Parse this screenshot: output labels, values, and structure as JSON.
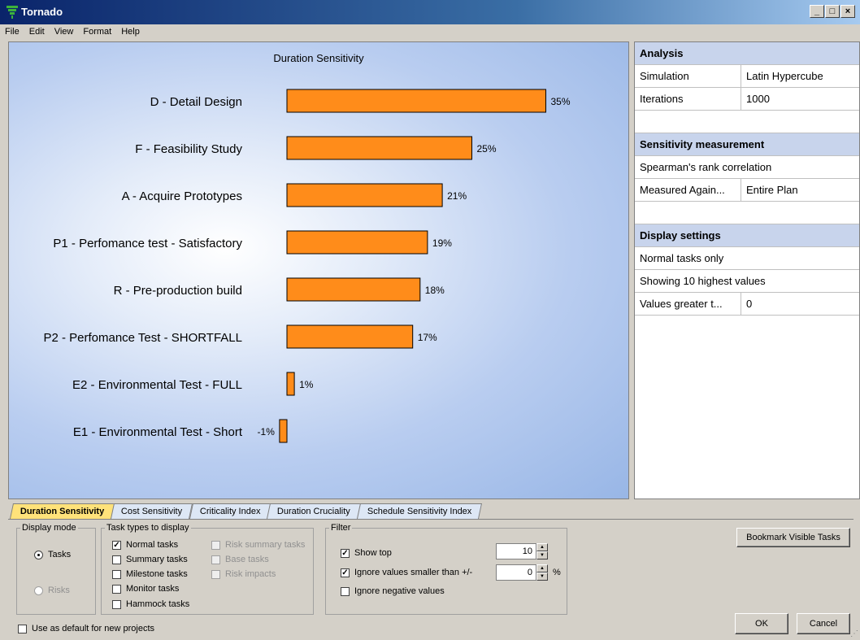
{
  "window": {
    "title": "Tornado"
  },
  "menu": [
    "File",
    "Edit",
    "View",
    "Format",
    "Help"
  ],
  "chart_data": {
    "type": "bar",
    "orientation": "horizontal",
    "title": "Duration Sensitivity",
    "categories": [
      "D - Detail Design",
      "F - Feasibility Study",
      "A - Acquire Prototypes",
      "P1 - Perfomance test - Satisfactory",
      "R - Pre-production build",
      "P2 - Perfomance Test - SHORTFALL",
      "E2 - Environmental Test - FULL",
      "E1 - Environmental Test - Short"
    ],
    "values": [
      35,
      25,
      21,
      19,
      18,
      17,
      1,
      -1
    ],
    "value_labels": [
      "35%",
      "25%",
      "21%",
      "19%",
      "18%",
      "17%",
      "1%",
      "-1%"
    ],
    "bar_color": "#ff8c1a",
    "grid": false
  },
  "panel": {
    "analysis": {
      "header": "Analysis",
      "rows": [
        {
          "label": "Simulation",
          "value": "Latin Hypercube"
        },
        {
          "label": "Iterations",
          "value": "1000"
        }
      ]
    },
    "sensitivity": {
      "header": "Sensitivity measurement",
      "line": "Spearman's rank correlation",
      "rows": [
        {
          "label": "Measured Again...",
          "value": "Entire Plan"
        }
      ]
    },
    "display": {
      "header": "Display settings",
      "lines": [
        "Normal tasks only",
        "Showing 10 highest values"
      ],
      "rows": [
        {
          "label": "Values greater t...",
          "value": "0"
        }
      ]
    }
  },
  "tabs": [
    "Duration Sensitivity",
    "Cost Sensitivity",
    "Criticality Index",
    "Duration Cruciality",
    "Schedule Sensitivity Index"
  ],
  "display_mode": {
    "legend": "Display mode",
    "tasks": "Tasks",
    "risks": "Risks"
  },
  "task_types": {
    "legend": "Task types to display",
    "normal": "Normal tasks",
    "summary": "Summary tasks",
    "milestone": "Milestone tasks",
    "monitor": "Monitor tasks",
    "hammock": "Hammock tasks",
    "risk_summary": "Risk summary tasks",
    "base": "Base tasks",
    "risk_impacts": "Risk impacts"
  },
  "filter": {
    "legend": "Filter",
    "show_top": "Show top",
    "show_top_value": "10",
    "ignore_smaller": "Ignore values smaller than +/-",
    "ignore_smaller_value": "0",
    "percent": "%",
    "ignore_negative": "Ignore negative values"
  },
  "buttons": {
    "bookmark": "Bookmark Visible Tasks",
    "ok": "OK",
    "cancel": "Cancel"
  },
  "default_checkbox": "Use as default for new projects"
}
